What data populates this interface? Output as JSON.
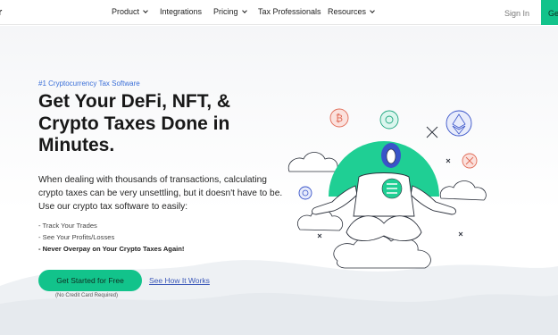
{
  "nav": {
    "logo_fragment": "r",
    "items": [
      {
        "label": "Product",
        "has_dropdown": true
      },
      {
        "label": "Integrations",
        "has_dropdown": false
      },
      {
        "label": "Pricing",
        "has_dropdown": true
      },
      {
        "label": "Tax Professionals",
        "has_dropdown": false
      },
      {
        "label": "Resources",
        "has_dropdown": true
      }
    ],
    "sign_in": "Sign In",
    "get_started_fragment": "Ge"
  },
  "hero": {
    "tagline": "#1 Cryptocurrency Tax Software",
    "headline": "Get Your DeFi, NFT, & Crypto Taxes Done in Minutes.",
    "description": "When dealing with thousands of transactions, calculating crypto taxes can be very unsettling, but it doesn't have to be. Use our crypto tax software to easily:",
    "bullets": [
      "- Track Your Trades",
      "- See Your Profits/Losses",
      "- Never Overpay on Your Crypto Taxes Again!"
    ],
    "cta_primary": "Get Started for Free",
    "cta_secondary": "See How It Works",
    "cta_note": "(No Credit Card Required)"
  },
  "colors": {
    "accent": "#12c38b",
    "link": "#3a57b8",
    "tagline": "#3a6fd8"
  }
}
